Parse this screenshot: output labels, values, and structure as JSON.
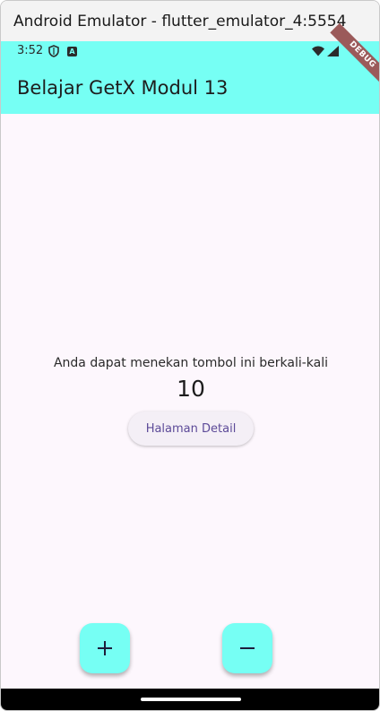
{
  "window": {
    "title": "Android Emulator - flutter_emulator_4:5554"
  },
  "status_bar": {
    "time": "3:52",
    "icons": [
      "shield-icon",
      "notification-a-icon",
      "wifi-icon",
      "signal-icon"
    ],
    "debug_banner": "DEBUG"
  },
  "app_bar": {
    "title": "Belajar GetX Modul 13",
    "color": "#76fff4"
  },
  "body": {
    "message": "Anda dapat menekan tombol ini berkali-kali",
    "counter": "10",
    "detail_button_label": "Halaman Detail"
  },
  "fabs": {
    "increment_symbol": "+",
    "decrement_symbol": "−",
    "color": "#76fff4"
  },
  "colors": {
    "background": "#fdf7fd",
    "accent_text": "#5c4a98"
  }
}
